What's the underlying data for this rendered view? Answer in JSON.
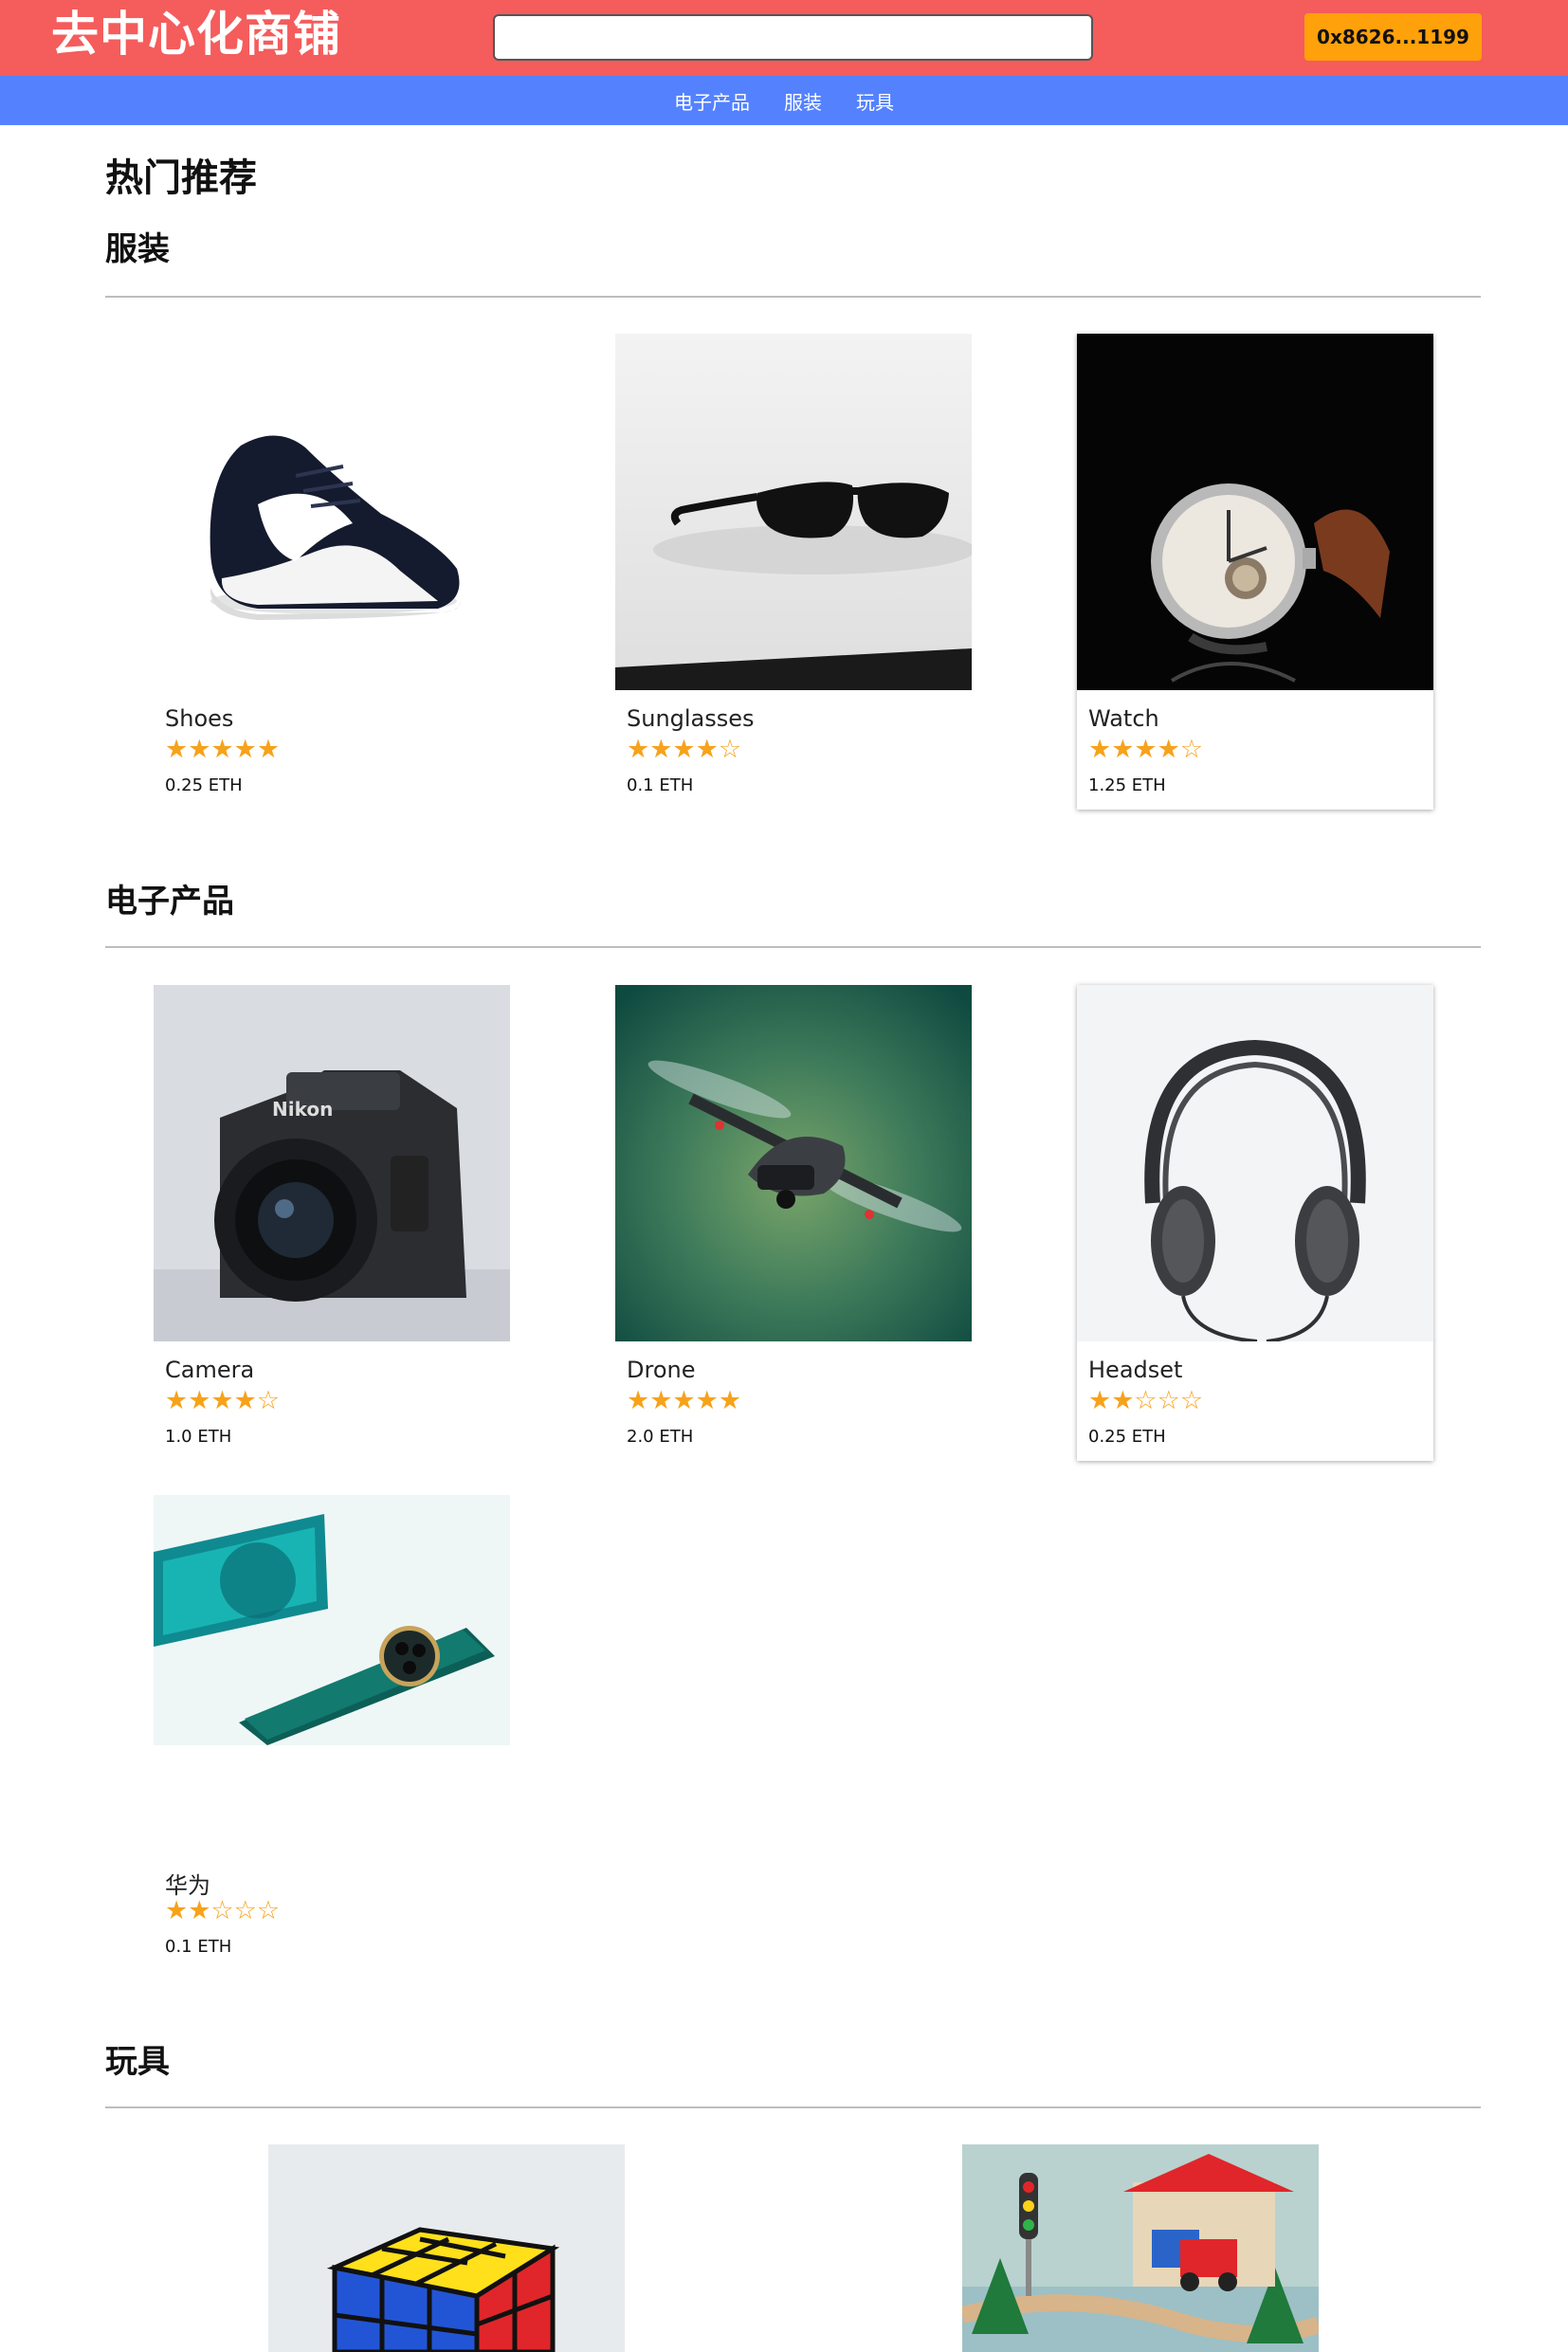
{
  "header": {
    "logo": "去中心化商铺",
    "search_placeholder": "",
    "wallet_label": "0x8626...1199",
    "brand_color": "#f55c5c",
    "nav_color": "#5482ff",
    "wallet_color": "#ffa10a"
  },
  "nav": {
    "items": [
      {
        "label": "电子产品"
      },
      {
        "label": "服装"
      },
      {
        "label": "玩具"
      }
    ]
  },
  "page": {
    "title": "热门推荐"
  },
  "sections": [
    {
      "title": "服装",
      "products": [
        {
          "name": "Shoes",
          "rating": 5,
          "stars": "★★★★★",
          "price": "0.25 ETH",
          "image": "shoe-image"
        },
        {
          "name": "Sunglasses",
          "rating": 4,
          "stars": "★★★★☆",
          "price": "0.1 ETH",
          "image": "sunglasses-image"
        },
        {
          "name": "Watch",
          "rating": 4,
          "stars": "★★★★☆",
          "price": "1.25 ETH",
          "image": "watch-image"
        }
      ]
    },
    {
      "title": "电子产品",
      "products": [
        {
          "name": "Camera",
          "rating": 4,
          "stars": "★★★★☆",
          "price": "1.0 ETH",
          "image": "camera-image"
        },
        {
          "name": "Drone",
          "rating": 5,
          "stars": "★★★★★",
          "price": "2.0 ETH",
          "image": "drone-image"
        },
        {
          "name": "Headset",
          "rating": 2,
          "stars": "★★☆☆☆",
          "price": "0.25 ETH",
          "image": "headset-image"
        },
        {
          "name": "华为",
          "rating": 2,
          "stars": "★★☆☆☆",
          "price": "0.1 ETH",
          "image": "phone-image"
        }
      ]
    },
    {
      "title": "玩具",
      "products": [
        {
          "image": "rubiks-cube-image"
        },
        {
          "image": "toy-train-station-image"
        }
      ]
    }
  ],
  "colors": {
    "star": "#f7a21b",
    "divider": "#bdbdbd"
  }
}
